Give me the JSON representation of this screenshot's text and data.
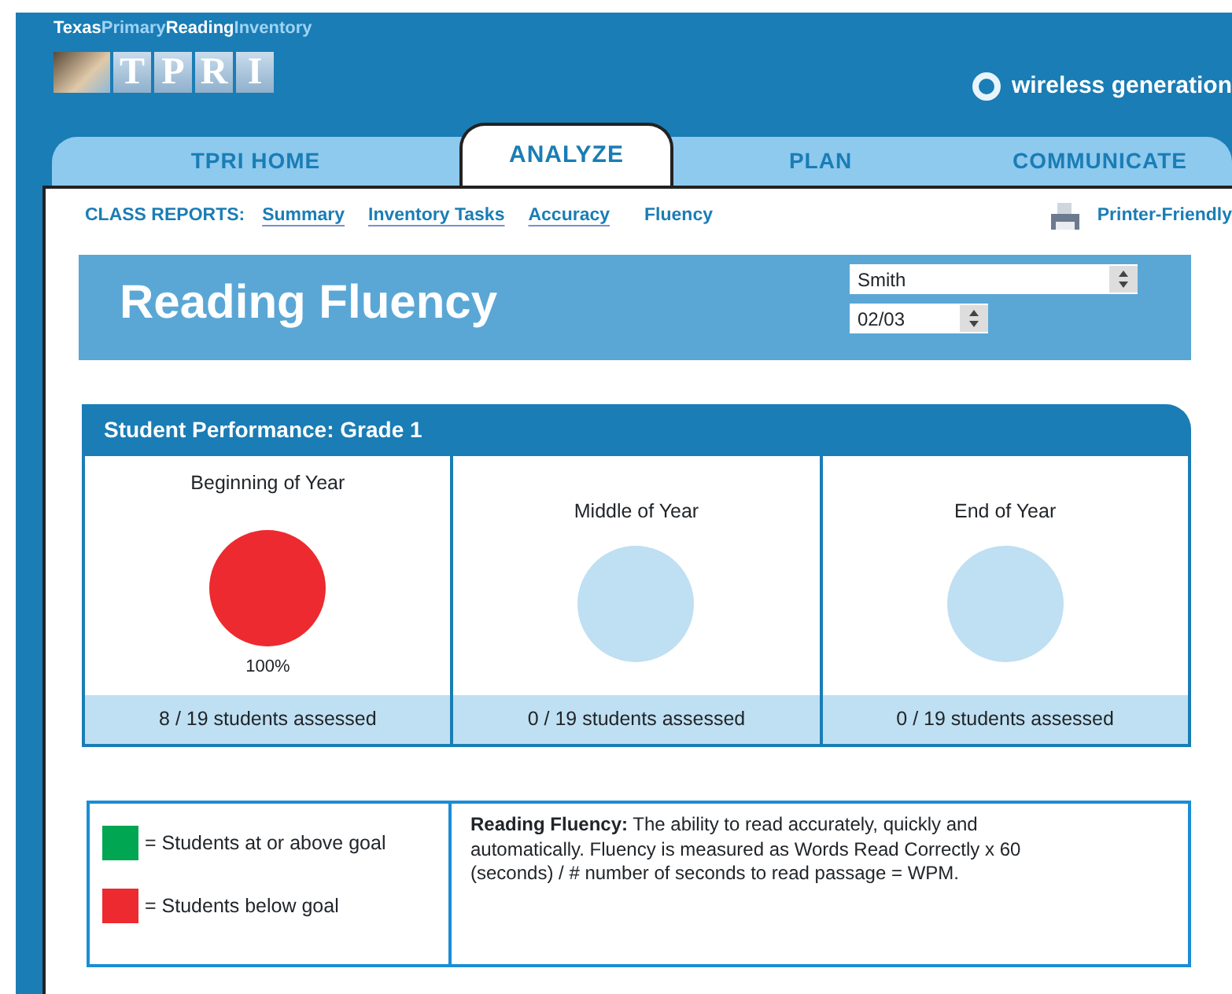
{
  "brand": {
    "tagline": [
      {
        "text": "Texas",
        "highlighted": false
      },
      {
        "text": "Primary",
        "highlighted": true
      },
      {
        "text": "Reading",
        "highlighted": false
      },
      {
        "text": "Inventory",
        "highlighted": true
      }
    ],
    "logo_letters": [
      "T",
      "P",
      "R",
      "I"
    ],
    "partner": "wireless generation"
  },
  "tabs": [
    {
      "label": "TPRI HOME",
      "selected": false
    },
    {
      "label": "ANALYZE",
      "selected": true
    },
    {
      "label": "PLAN",
      "selected": false
    },
    {
      "label": "COMMUNICATE",
      "selected": false
    }
  ],
  "report_nav": {
    "label": "CLASS REPORTS:",
    "links": [
      {
        "label": "Summary",
        "selected": false
      },
      {
        "label": "Inventory Tasks",
        "selected": false
      },
      {
        "label": "Accuracy",
        "selected": false
      },
      {
        "label": "Fluency",
        "selected": true
      }
    ],
    "printer": "Printer-Friendly"
  },
  "title": "Reading Fluency",
  "teacher_select": {
    "value": "Smith"
  },
  "date_select": {
    "value": "02/03"
  },
  "performance": {
    "title": "Student Performance: Grade 1",
    "periods": [
      {
        "label": "Beginning of Year",
        "color": "#ed2a2f",
        "percent": "100%",
        "footer": "8 / 19 students assessed"
      },
      {
        "label": "Middle of Year",
        "footer": "0 / 19 students assessed"
      },
      {
        "label": "End of Year",
        "footer": "0 / 19 students assessed"
      }
    ]
  },
  "legend": [
    {
      "color": "#00a651",
      "label": "= Students at or above goal"
    },
    {
      "color": "#ed2a2f",
      "label": "= Students below goal"
    }
  ],
  "definition": "**Reading Fluency:** The ability to read accurately, quickly and automatically. Fluency is measured as Words Read Correctly x 60 (seconds) / # number of seconds to read passage = WPM."
}
